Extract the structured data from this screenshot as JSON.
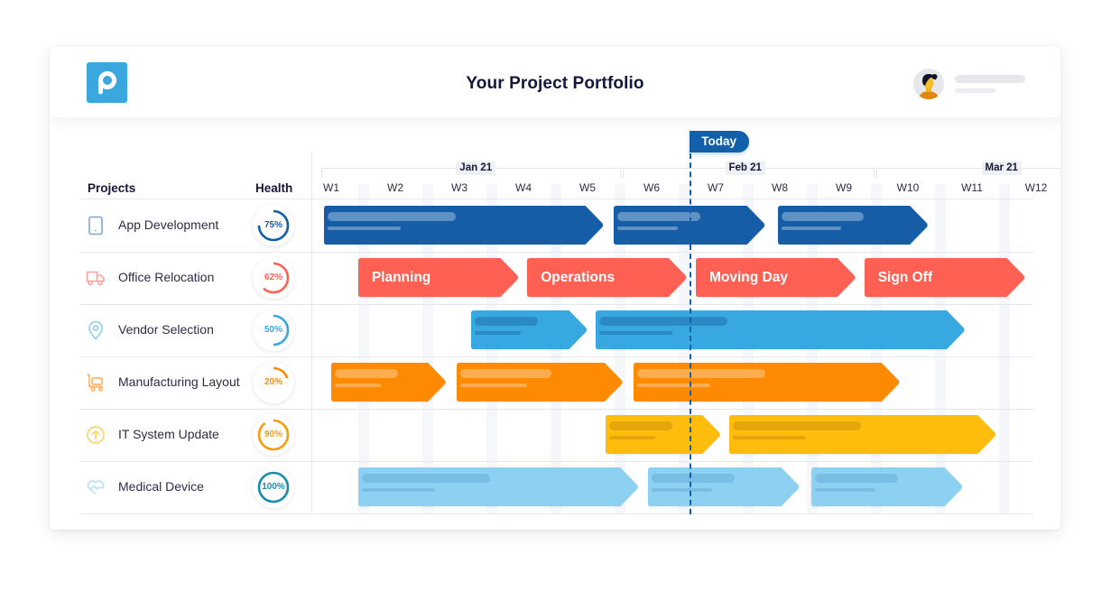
{
  "header": {
    "title": "Your Project Portfolio",
    "logo_icon": "p-logo-icon",
    "user_avatar_icon": "user-avatar-icon"
  },
  "columns": {
    "projects": "Projects",
    "health": "Health"
  },
  "timeline": {
    "today_label": "Today",
    "today_position_week": 6.61,
    "months": [
      {
        "label": "Jan 21",
        "from_week": 0.85,
        "to_week": 5.5,
        "label_week": 3.3
      },
      {
        "label": "Feb 21",
        "from_week": 5.55,
        "to_week": 9.45,
        "label_week": 7.5
      },
      {
        "label": "Mar 21",
        "from_week": 9.5,
        "to_week": 13.0,
        "label_week": 11.5
      }
    ],
    "weeks": [
      "W1",
      "W2",
      "W3",
      "W4",
      "W5",
      "W6",
      "W7",
      "W8",
      "W9",
      "W10",
      "W11",
      "W12"
    ]
  },
  "colors": {
    "dark_blue": "#125da8",
    "coral": "#fe6152",
    "sky_blue": "#37a8e0",
    "orange": "#fd8a03",
    "amber": "#febd10",
    "light_blue": "#8dd1f2",
    "today": "#1260aa"
  },
  "projects": [
    {
      "name": "App Development",
      "icon": "tablet-icon",
      "icon_color": "#7fa6d2",
      "health": 75,
      "health_color": "#125da8",
      "bar_color": "#125da8",
      "ph_color": "rgba(255,255,255,0.32)",
      "bars": [
        {
          "start": 0.89,
          "end": 5.25,
          "label": ""
        },
        {
          "start": 5.41,
          "end": 7.77,
          "label": ""
        },
        {
          "start": 7.97,
          "end": 10.31,
          "label": ""
        }
      ]
    },
    {
      "name": "Office Relocation",
      "icon": "truck-icon",
      "icon_color": "#fea39b",
      "health": 62,
      "health_color": "#fe6152",
      "bar_color": "#fe6152",
      "ph_color": "",
      "bars": [
        {
          "start": 1.42,
          "end": 3.92,
          "label": "Planning"
        },
        {
          "start": 4.06,
          "end": 6.55,
          "label": "Operations"
        },
        {
          "start": 6.69,
          "end": 9.18,
          "label": "Moving Day"
        },
        {
          "start": 9.32,
          "end": 11.82,
          "label": "Sign Off"
        }
      ]
    },
    {
      "name": "Vendor Selection",
      "icon": "location-pin-icon",
      "icon_color": "#8ccdee",
      "health": 50,
      "health_color": "#37a8e0",
      "bar_color": "#37a8e0",
      "ph_color": "rgba(20,80,140,0.35)",
      "bars": [
        {
          "start": 3.18,
          "end": 4.99,
          "label": ""
        },
        {
          "start": 5.13,
          "end": 10.89,
          "label": ""
        }
      ]
    },
    {
      "name": "Manufacturing Layout",
      "icon": "cart-icon",
      "icon_color": "#fdb36b",
      "health": 20,
      "health_color": "#fd8a03",
      "bar_color": "#fd8a03",
      "ph_color": "rgba(255,255,255,0.30)",
      "bars": [
        {
          "start": 1.0,
          "end": 2.79,
          "label": ""
        },
        {
          "start": 2.96,
          "end": 5.55,
          "label": ""
        },
        {
          "start": 5.72,
          "end": 9.87,
          "label": ""
        }
      ]
    },
    {
      "name": "IT System Update",
      "icon": "arrow-up-circle-icon",
      "icon_color": "#fed46e",
      "health": 90,
      "health_color": "#f59e0b",
      "bar_color": "#febd10",
      "ph_color": "rgba(150,100,0,0.25)",
      "bars": [
        {
          "start": 5.28,
          "end": 7.07,
          "label": ""
        },
        {
          "start": 7.21,
          "end": 11.37,
          "label": ""
        }
      ]
    },
    {
      "name": "Medical Device",
      "icon": "heart-pulse-icon",
      "icon_color": "#b8e1f6",
      "health": 100,
      "health_color": "#1a8cae",
      "bar_color": "#8dd1f2",
      "ph_color": "rgba(40,110,170,0.20)",
      "bars": [
        {
          "start": 1.42,
          "end": 5.79,
          "label": ""
        },
        {
          "start": 5.94,
          "end": 8.3,
          "label": ""
        },
        {
          "start": 8.49,
          "end": 10.85,
          "label": ""
        }
      ]
    }
  ]
}
